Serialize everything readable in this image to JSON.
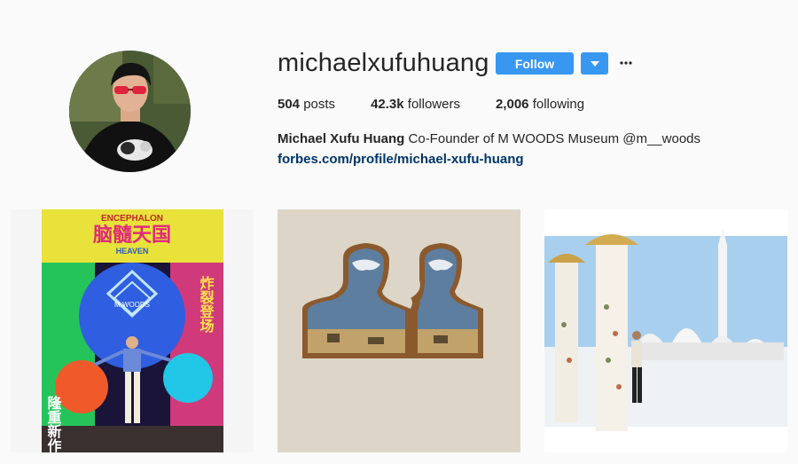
{
  "profile": {
    "username": "michaelxufuhuang",
    "follow_label": "Follow",
    "dropdown_icon": "caret-down-icon",
    "more_icon": "ellipsis-icon",
    "stats": {
      "posts_count": "504",
      "posts_label": "posts",
      "followers_count": "42.3k",
      "followers_label": "followers",
      "following_count": "2,006",
      "following_label": "following"
    },
    "full_name": "Michael Xufu Huang",
    "bio": "Co-Founder of M WOODS Museum @m__woods",
    "website": "forbes.com/profile/michael-xufu-huang"
  },
  "colors": {
    "accent": "#3897f0",
    "link": "#003569",
    "background": "#fafafa",
    "text": "#262626"
  },
  "posts": [
    {
      "headline": "ENCEPHALON",
      "chinese": "脑髓天国",
      "subtitle": "HEAVEN",
      "center": "M WOODS",
      "left_vertical": "隆重新作",
      "right_vertical": "炸裂登场"
    },
    {},
    {}
  ]
}
